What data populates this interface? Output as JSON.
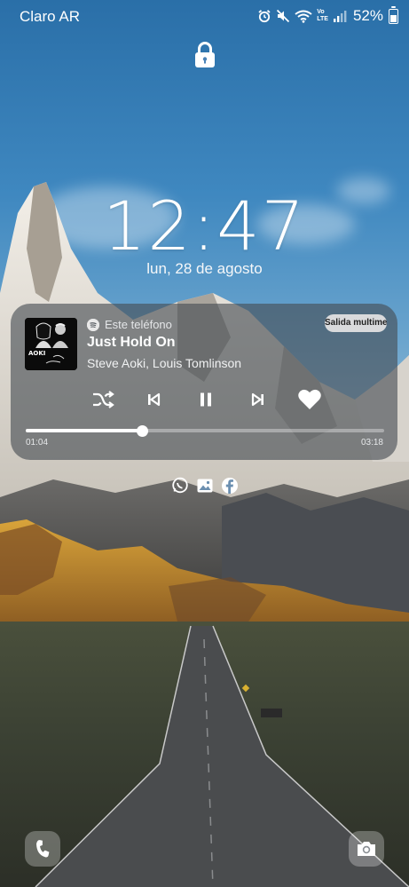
{
  "status_bar": {
    "carrier": "Claro AR",
    "battery_percent": "52%",
    "battery_level": 0.52,
    "icons": [
      "alarm-icon",
      "mute-icon",
      "wifi-icon",
      "volte-icon",
      "signal-icon",
      "battery-icon"
    ],
    "volte_label_top": "Vo",
    "volte_label_bottom": "LTE"
  },
  "lock": {
    "icon": "lock-icon"
  },
  "clock": {
    "time": "12:47",
    "date": "lun, 28 de agosto"
  },
  "media": {
    "source_app": "spotify",
    "source_label": "Este teléfono",
    "output_button": "Salida multime...",
    "title": "Just Hold On",
    "artist": "Steve Aoki, Louis Tomlinson",
    "album_art_text": "AOKI",
    "current_time": "01:04",
    "total_time": "03:18",
    "progress": 0.3232,
    "controls": [
      "shuffle-icon",
      "previous-icon",
      "pause-icon",
      "next-icon",
      "heart-icon"
    ]
  },
  "notifications": [
    "whatsapp-icon",
    "gallery-icon",
    "facebook-icon"
  ],
  "shortcuts": {
    "left": "phone-icon",
    "right": "camera-icon"
  }
}
